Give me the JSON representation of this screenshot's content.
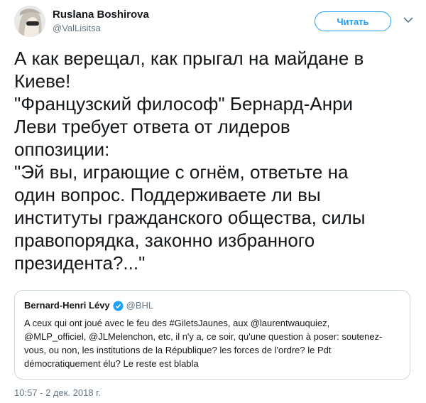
{
  "author": {
    "display_name": "Ruslana Boshirova",
    "handle": "@ValLisitsa"
  },
  "follow_button": {
    "label": "Читать"
  },
  "icons": {
    "avatar": "avatar-photo",
    "caret": "chevron-down-icon",
    "verified": "verified-badge-icon"
  },
  "colors": {
    "accent": "#1da1f2",
    "secondary_text": "#657786",
    "border": "#ccd6dd"
  },
  "tweet": {
    "lines": [
      "А как верещал, как прыгал на майдане в",
      "Киеве!",
      "\"Французский философ\" Бернард-Анри",
      "Леви требует ответа от лидеров",
      "оппозиции:",
      "\"Эй вы, играющие с огнём, ответьте на",
      "один вопрос. Поддерживаете ли вы",
      "институты гражданского общества, силы",
      "правопорядка, законно избранного",
      "президента?...\""
    ],
    "timestamp": "10:57 - 2 дек. 2018 г."
  },
  "quoted_tweet": {
    "display_name": "Bernard-Henri Lévy",
    "handle": "@BHL",
    "lines": [
      "A ceux qui ont joué avec le feu des #GiletsJaunes, aux @laurentwauquiez,",
      "@MLP_officiel, @JLMelenchon, etc, il n'y a, ce soir, qu'une question à poser: soutenez-",
      "vous, ou non, les institutions de la République? les forces de l'ordre? le Pdt",
      "démocratiquement élu? Le reste est blabla"
    ]
  }
}
